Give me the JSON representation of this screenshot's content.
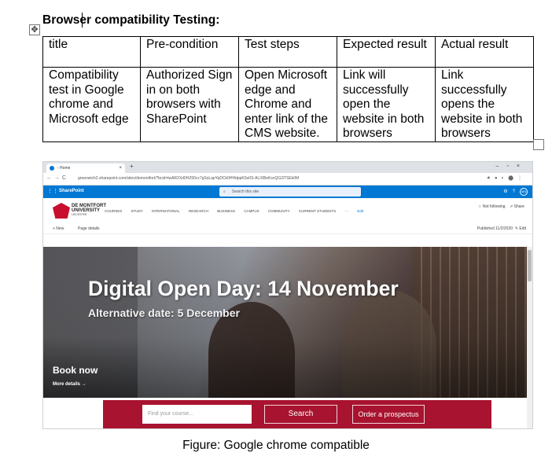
{
  "heading": "Browser compatibility Testing:",
  "table": {
    "headers": [
      "title",
      "Pre-condition",
      "Test steps",
      "Expected result",
      "Actual result"
    ],
    "rows": [
      [
        "Compatibility test in Google chrome and Microsoft edge",
        "Authorized Sign in on both browsers with SharePoint",
        "Open Microsoft edge and Chrome and enter link of the CMS website.",
        "Link will successfully open the website in both browsers",
        "Link successfully opens the website in both browsers"
      ]
    ]
  },
  "screenshot": {
    "browser": {
      "tab_title": "- Home",
      "url": "greenwich2.sharepoint.com/sites/demontfort/?bcid=lwAR2Xd0HZ60cc7gSsLapYqDCk0HHdppK0u0S-ALIXBeKsvQG2iTSEk0M"
    },
    "sharepoint": {
      "app_name": "SharePoint",
      "search_placeholder": "Search this site",
      "avatar": "MA"
    },
    "site": {
      "logo_line1": "DE MONTFORT",
      "logo_line2": "UNIVERSITY",
      "logo_line3": "LEICESTER",
      "nav_items": [
        "COURSES",
        "STUDY",
        "INTERNATIONAL",
        "RESEARCH",
        "BUSINESS",
        "CAMPUS",
        "COMMUNITY",
        "CURRENT STUDENTS",
        "···",
        "Edit"
      ],
      "not_following": "☆ Not following",
      "share": "⇗ Share",
      "new_label": "+ New",
      "page_details": "Page details",
      "published": "Published 11/2/2020",
      "edit": "Edit"
    },
    "hero": {
      "title": "Digital Open Day: 14 November",
      "subtitle": "Alternative date: 5 December",
      "book_now": "Book now",
      "more_details": "More details →"
    },
    "search_strip": {
      "course_placeholder": "Find your course...",
      "search_button": "Search",
      "prospectus_button": "Order a prospectus"
    }
  },
  "caption": "Figure: Google chrome compatible"
}
